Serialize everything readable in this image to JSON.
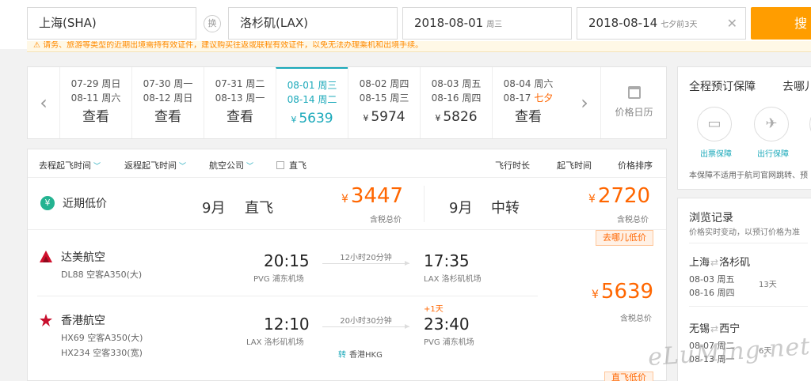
{
  "search": {
    "from": "上海(SHA)",
    "swap_label": "换",
    "to": "洛杉矶(LAX)",
    "depart_date": "2018-08-01",
    "depart_weekday": "周三",
    "return_date": "2018-08-14",
    "return_note": "七夕前3天",
    "clear": "✕",
    "button": "搜"
  },
  "notice": "⚠ 请务、旅游等类型的近期出境需持有效证件，建议购买往返或联程有效证件，以免无法办理乘机和出境手续。",
  "date_strip": {
    "cells": [
      {
        "line1": "07-29 周日",
        "line2": "08-11 周六",
        "price": "查看",
        "has_yen": false
      },
      {
        "line1": "07-30 周一",
        "line2": "08-12 周日",
        "price": "查看",
        "has_yen": false
      },
      {
        "line1": "07-31 周二",
        "line2": "08-13 周一",
        "price": "查看",
        "has_yen": false
      },
      {
        "line1": "08-01 周三",
        "line2": "08-14 周二",
        "price": "5639",
        "has_yen": true,
        "selected": true
      },
      {
        "line1": "08-02 周四",
        "line2": "08-15 周三",
        "price": "5974",
        "has_yen": true
      },
      {
        "line1": "08-03 周五",
        "line2": "08-16 周四",
        "price": "5826",
        "has_yen": true
      },
      {
        "line1": "08-04 周六",
        "line2": "08-17",
        "line2_extra": "七夕",
        "price": "查看",
        "has_yen": false
      }
    ],
    "calendar_label": "价格日历"
  },
  "filters": {
    "depart_time": "去程起飞时间",
    "return_time": "返程起飞时间",
    "airline": "航空公司",
    "direct": "直飞",
    "sort_duration": "飞行时长",
    "sort_depart": "起飞时间",
    "sort_price": "价格排序"
  },
  "recent_low": {
    "icon": "¥",
    "label": "近期低价",
    "direct": {
      "month": "9月",
      "type": "直飞",
      "price": "3447",
      "tax": "含税总价"
    },
    "transfer": {
      "month": "9月",
      "type": "中转",
      "price": "2720",
      "tax": "含税总价"
    }
  },
  "result": {
    "badge": "去哪儿低价",
    "outbound": {
      "airline": "达美航空",
      "flight": "DL88 空客A350(大)",
      "dep_time": "20:15",
      "dep_airport": "PVG 浦东机场",
      "duration": "12小时20分钟",
      "arr_time": "17:35",
      "arr_airport": "LAX 洛杉矶机场"
    },
    "inbound": {
      "airline": "香港航空",
      "flight1": "HX69 空客A350(大)",
      "flight2": "HX234 空客330(宽)",
      "dep_time": "12:10",
      "dep_airport": "LAX 洛杉矶机场",
      "duration": "20小时30分钟",
      "plus_day": "+1天",
      "arr_time": "23:40",
      "arr_airport": "PVG 浦东机场",
      "transfer_icon": "转",
      "transfer_city": "香港HKG"
    },
    "yen": "¥",
    "price": "5639",
    "tax": "含税总价",
    "next_badge": "直飞低价"
  },
  "sidebar": {
    "guarantee_title": "全程预订保障",
    "where_title": "去哪儿",
    "ticket_label": "出票保障",
    "travel_label": "出行保障",
    "guarantee_note": "本保障不适用于航司官网跳转、预",
    "history_title": "浏览记录",
    "history_sub": "价格实时变动，以预订价格为准",
    "records": [
      {
        "from": "上海",
        "to": "洛杉矶",
        "d1": "08-03 周五",
        "d2": "08-16 周四",
        "days": "13天"
      },
      {
        "from": "无锡",
        "to": "西宁",
        "d1": "08-07 周二",
        "d2": "08-13 周一",
        "days": "6天"
      }
    ]
  },
  "watermark": "eLuMing.net",
  "colors": {
    "accent": "#1ba9ba",
    "price": "#ff6600",
    "search_button": "#ff9d00"
  }
}
